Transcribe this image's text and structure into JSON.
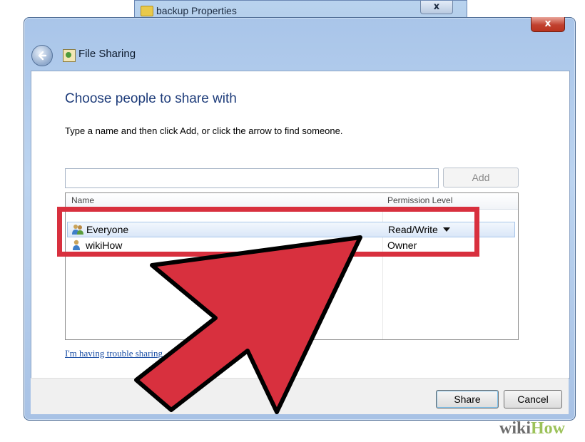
{
  "background_window": {
    "title": "backup Properties",
    "close_label": "x"
  },
  "dialog": {
    "close_label": "x",
    "title": "File Sharing",
    "heading": "Choose people to share with",
    "instruction": "Type a name and then click Add, or click the arrow to find someone.",
    "name_input": {
      "value": "",
      "placeholder": ""
    },
    "add_label": "Add",
    "list": {
      "columns": [
        "Name",
        "Permission Level"
      ],
      "rows": [
        {
          "name": "Everyone",
          "permission": "Read/Write",
          "icon": "group-icon",
          "selected": true
        },
        {
          "name": "wikiHow",
          "permission": "Owner",
          "icon": "user-icon",
          "selected": false
        }
      ]
    },
    "help_link": "I'm having trouble sharing",
    "share_label": "Share",
    "cancel_label": "Cancel"
  },
  "annotation": {
    "highlight_color": "#d8303e",
    "arrow_color": "#d8303e",
    "arrow_icon": "pointer-arrow-icon"
  },
  "watermark": {
    "part1": "wiki",
    "part2": "How"
  }
}
